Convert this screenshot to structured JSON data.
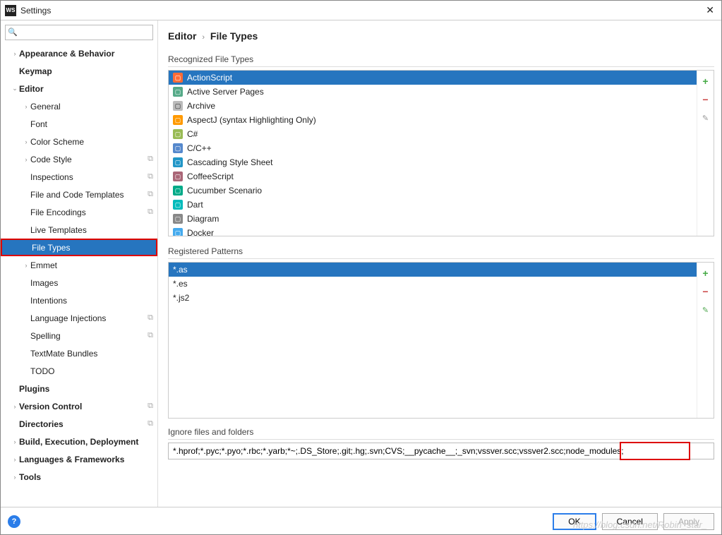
{
  "window": {
    "title": "Settings",
    "app_icon_text": "WS"
  },
  "search": {
    "placeholder": ""
  },
  "tree": [
    {
      "label": "Appearance & Behavior",
      "level": 0,
      "bold": true,
      "arrow": "›",
      "name": "sidebar-item-appearance"
    },
    {
      "label": "Keymap",
      "level": 0,
      "bold": true,
      "arrow": "",
      "name": "sidebar-item-keymap"
    },
    {
      "label": "Editor",
      "level": 0,
      "bold": true,
      "arrow": "⌄",
      "name": "sidebar-item-editor"
    },
    {
      "label": "General",
      "level": 1,
      "arrow": "›",
      "name": "sidebar-item-general"
    },
    {
      "label": "Font",
      "level": 1,
      "arrow": "",
      "name": "sidebar-item-font"
    },
    {
      "label": "Color Scheme",
      "level": 1,
      "arrow": "›",
      "name": "sidebar-item-color-scheme"
    },
    {
      "label": "Code Style",
      "level": 1,
      "arrow": "›",
      "copy": true,
      "name": "sidebar-item-code-style"
    },
    {
      "label": "Inspections",
      "level": 1,
      "arrow": "",
      "copy": true,
      "name": "sidebar-item-inspections"
    },
    {
      "label": "File and Code Templates",
      "level": 1,
      "arrow": "",
      "copy": true,
      "name": "sidebar-item-file-templates"
    },
    {
      "label": "File Encodings",
      "level": 1,
      "arrow": "",
      "copy": true,
      "name": "sidebar-item-file-encodings"
    },
    {
      "label": "Live Templates",
      "level": 1,
      "arrow": "",
      "name": "sidebar-item-live-templates"
    },
    {
      "label": "File Types",
      "level": 1,
      "arrow": "",
      "selected": true,
      "name": "sidebar-item-file-types"
    },
    {
      "label": "Emmet",
      "level": 1,
      "arrow": "›",
      "name": "sidebar-item-emmet"
    },
    {
      "label": "Images",
      "level": 1,
      "arrow": "",
      "name": "sidebar-item-images"
    },
    {
      "label": "Intentions",
      "level": 1,
      "arrow": "",
      "name": "sidebar-item-intentions"
    },
    {
      "label": "Language Injections",
      "level": 1,
      "arrow": "",
      "copy": true,
      "name": "sidebar-item-lang-inj"
    },
    {
      "label": "Spelling",
      "level": 1,
      "arrow": "",
      "copy": true,
      "name": "sidebar-item-spelling"
    },
    {
      "label": "TextMate Bundles",
      "level": 1,
      "arrow": "",
      "name": "sidebar-item-textmate"
    },
    {
      "label": "TODO",
      "level": 1,
      "arrow": "",
      "name": "sidebar-item-todo"
    },
    {
      "label": "Plugins",
      "level": 0,
      "bold": true,
      "arrow": "",
      "name": "sidebar-item-plugins"
    },
    {
      "label": "Version Control",
      "level": 0,
      "bold": true,
      "arrow": "›",
      "copy": true,
      "name": "sidebar-item-vcs"
    },
    {
      "label": "Directories",
      "level": 0,
      "bold": true,
      "arrow": "",
      "copy": true,
      "name": "sidebar-item-directories"
    },
    {
      "label": "Build, Execution, Deployment",
      "level": 0,
      "bold": true,
      "arrow": "›",
      "name": "sidebar-item-build"
    },
    {
      "label": "Languages & Frameworks",
      "level": 0,
      "bold": true,
      "arrow": "›",
      "name": "sidebar-item-lang-fw"
    },
    {
      "label": "Tools",
      "level": 0,
      "bold": true,
      "arrow": "›",
      "name": "sidebar-item-tools"
    }
  ],
  "breadcrumb": {
    "parent": "Editor",
    "current": "File Types"
  },
  "sections": {
    "recognized": "Recognized File Types",
    "patterns": "Registered Patterns",
    "ignore": "Ignore files and folders"
  },
  "file_types": [
    {
      "label": "ActionScript",
      "icon": "as",
      "selected": true
    },
    {
      "label": "Active Server Pages",
      "icon": "asp"
    },
    {
      "label": "Archive",
      "icon": "arc"
    },
    {
      "label": "AspectJ (syntax Highlighting Only)",
      "icon": "aj"
    },
    {
      "label": "C#",
      "icon": "cs"
    },
    {
      "label": "C/C++",
      "icon": "cpp"
    },
    {
      "label": "Cascading Style Sheet",
      "icon": "css"
    },
    {
      "label": "CoffeeScript",
      "icon": "cof"
    },
    {
      "label": "Cucumber Scenario",
      "icon": "cuc"
    },
    {
      "label": "Dart",
      "icon": "dart"
    },
    {
      "label": "Diagram",
      "icon": "diag"
    },
    {
      "label": "Docker",
      "icon": "dock"
    }
  ],
  "patterns": [
    {
      "label": "*.as",
      "selected": true
    },
    {
      "label": "*.es"
    },
    {
      "label": "*.js2"
    }
  ],
  "ignore_value": "*.hprof;*.pyc;*.pyo;*.rbc;*.yarb;*~;.DS_Store;.git;.hg;.svn;CVS;__pycache__;_svn;vssver.scc;vssver2.scc;node_modules;",
  "buttons": {
    "ok": "OK",
    "cancel": "Cancel",
    "apply": "Apply"
  },
  "help": "?",
  "watermark": "https://blog.csdn.net/Robin_star_"
}
